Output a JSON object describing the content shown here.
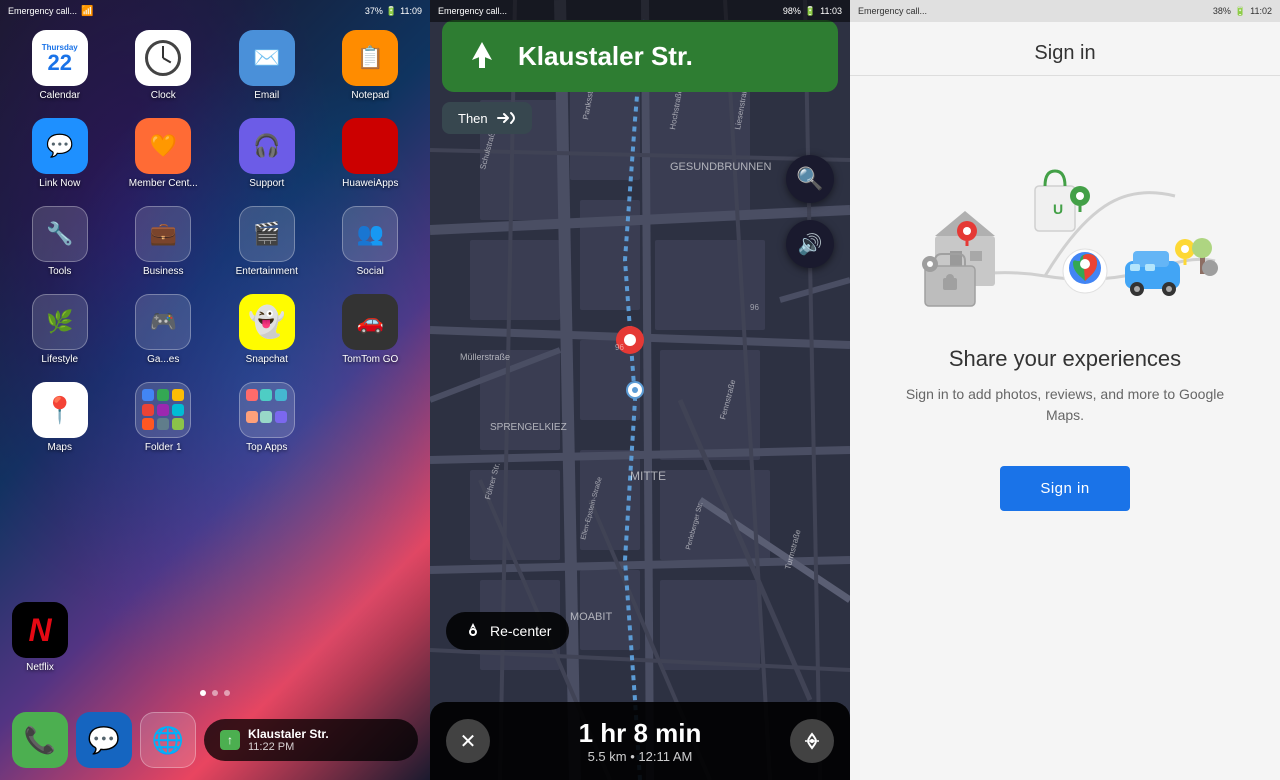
{
  "panel1": {
    "statusBar": {
      "carrier": "Emergency call...",
      "wifi": "WiFi",
      "battery": "37%",
      "time": "11:09"
    },
    "apps": [
      {
        "id": "calendar",
        "label": "Calendar",
        "icon": "calendar",
        "day": "22",
        "weekday": "Thursday"
      },
      {
        "id": "clock",
        "label": "Clock",
        "icon": "clock"
      },
      {
        "id": "email",
        "label": "Email",
        "icon": "email"
      },
      {
        "id": "notepad",
        "label": "Notepad",
        "icon": "notepad"
      },
      {
        "id": "linknow",
        "label": "Link Now",
        "icon": "linknow"
      },
      {
        "id": "membercent",
        "label": "Member Cent...",
        "icon": "member"
      },
      {
        "id": "support",
        "label": "Support",
        "icon": "support"
      },
      {
        "id": "huaweiapps",
        "label": "HuaweiApps",
        "icon": "huaweiapps"
      },
      {
        "id": "tools",
        "label": "Tools",
        "icon": "tools"
      },
      {
        "id": "business",
        "label": "Business",
        "icon": "business"
      },
      {
        "id": "entertainment",
        "label": "Entertainment",
        "icon": "entertainment"
      },
      {
        "id": "social",
        "label": "Social",
        "icon": "social"
      },
      {
        "id": "lifestyle",
        "label": "Lifestyle",
        "icon": "lifestyle"
      },
      {
        "id": "games",
        "label": "Ga...es",
        "icon": "games"
      },
      {
        "id": "snapchat",
        "label": "Snapchat",
        "icon": "snapchat"
      },
      {
        "id": "tomtom",
        "label": "TomTom GO",
        "icon": "tomtom"
      },
      {
        "id": "maps",
        "label": "Maps",
        "icon": "maps"
      },
      {
        "id": "folder1",
        "label": "Folder 1",
        "icon": "folder1"
      },
      {
        "id": "topapps",
        "label": "Top Apps",
        "icon": "topapps"
      },
      {
        "id": "netflix",
        "label": "Netflix",
        "icon": "netflix"
      }
    ],
    "dock": {
      "phone_icon": "📞",
      "messages_icon": "💬",
      "notification_title": "Klaustaler Str.",
      "notification_time": "11:22 PM"
    }
  },
  "panel2": {
    "statusBar": {
      "carrier": "Emergency call...",
      "battery": "98%",
      "time": "11:03"
    },
    "navigation": {
      "street": "Klaustaler Str.",
      "then_label": "Then",
      "eta_time": "1 hr 8 min",
      "eta_distance": "5.5 km",
      "eta_arrival": "12:11 AM",
      "recenter_label": "Re-center"
    },
    "streets": [
      "Schulstraße",
      "Panksstraße",
      "Hochstraße",
      "Liesenstraße",
      "Föhrer Str.",
      "Ellen-Epstein-Straße",
      "Perleberger Str.",
      "Fennstraße",
      "Turmstraße"
    ],
    "districts": [
      "GESUNDBRUNNEN",
      "SPRENGELKIEZ",
      "MITTE",
      "MOABIT"
    ]
  },
  "panel3": {
    "statusBar": {
      "carrier": "Emergency call...",
      "battery": "38%",
      "time": "11:02"
    },
    "title": "Sign in",
    "heading": "Share your experiences",
    "subtext": "Sign in to add photos, reviews, and more to Google Maps.",
    "button_label": "Sign in"
  }
}
